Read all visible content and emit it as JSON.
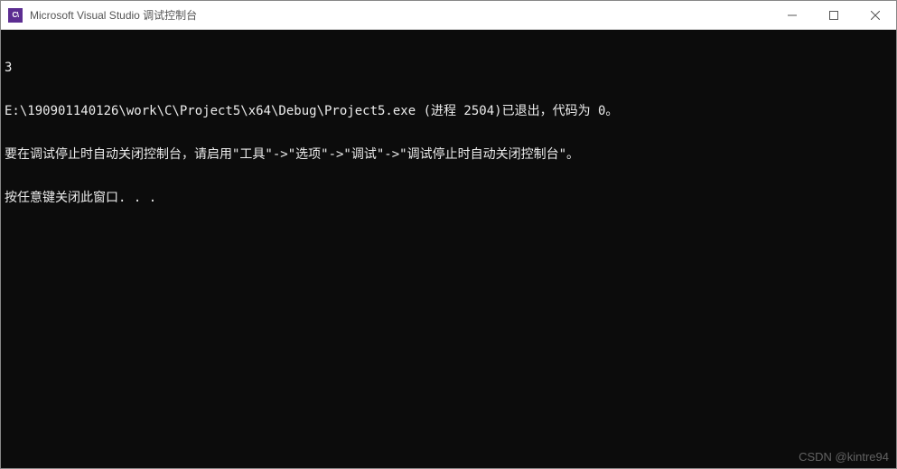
{
  "window": {
    "icon_label": "C\\",
    "title": "Microsoft Visual Studio 调试控制台"
  },
  "console": {
    "lines": [
      "3",
      "E:\\190901140126\\work\\C\\Project5\\x64\\Debug\\Project5.exe (进程 2504)已退出，代码为 0。",
      "要在调试停止时自动关闭控制台，请启用\"工具\"->\"选项\"->\"调试\"->\"调试停止时自动关闭控制台\"。",
      "按任意键关闭此窗口. . ."
    ]
  },
  "watermark": "CSDN @kintre94"
}
